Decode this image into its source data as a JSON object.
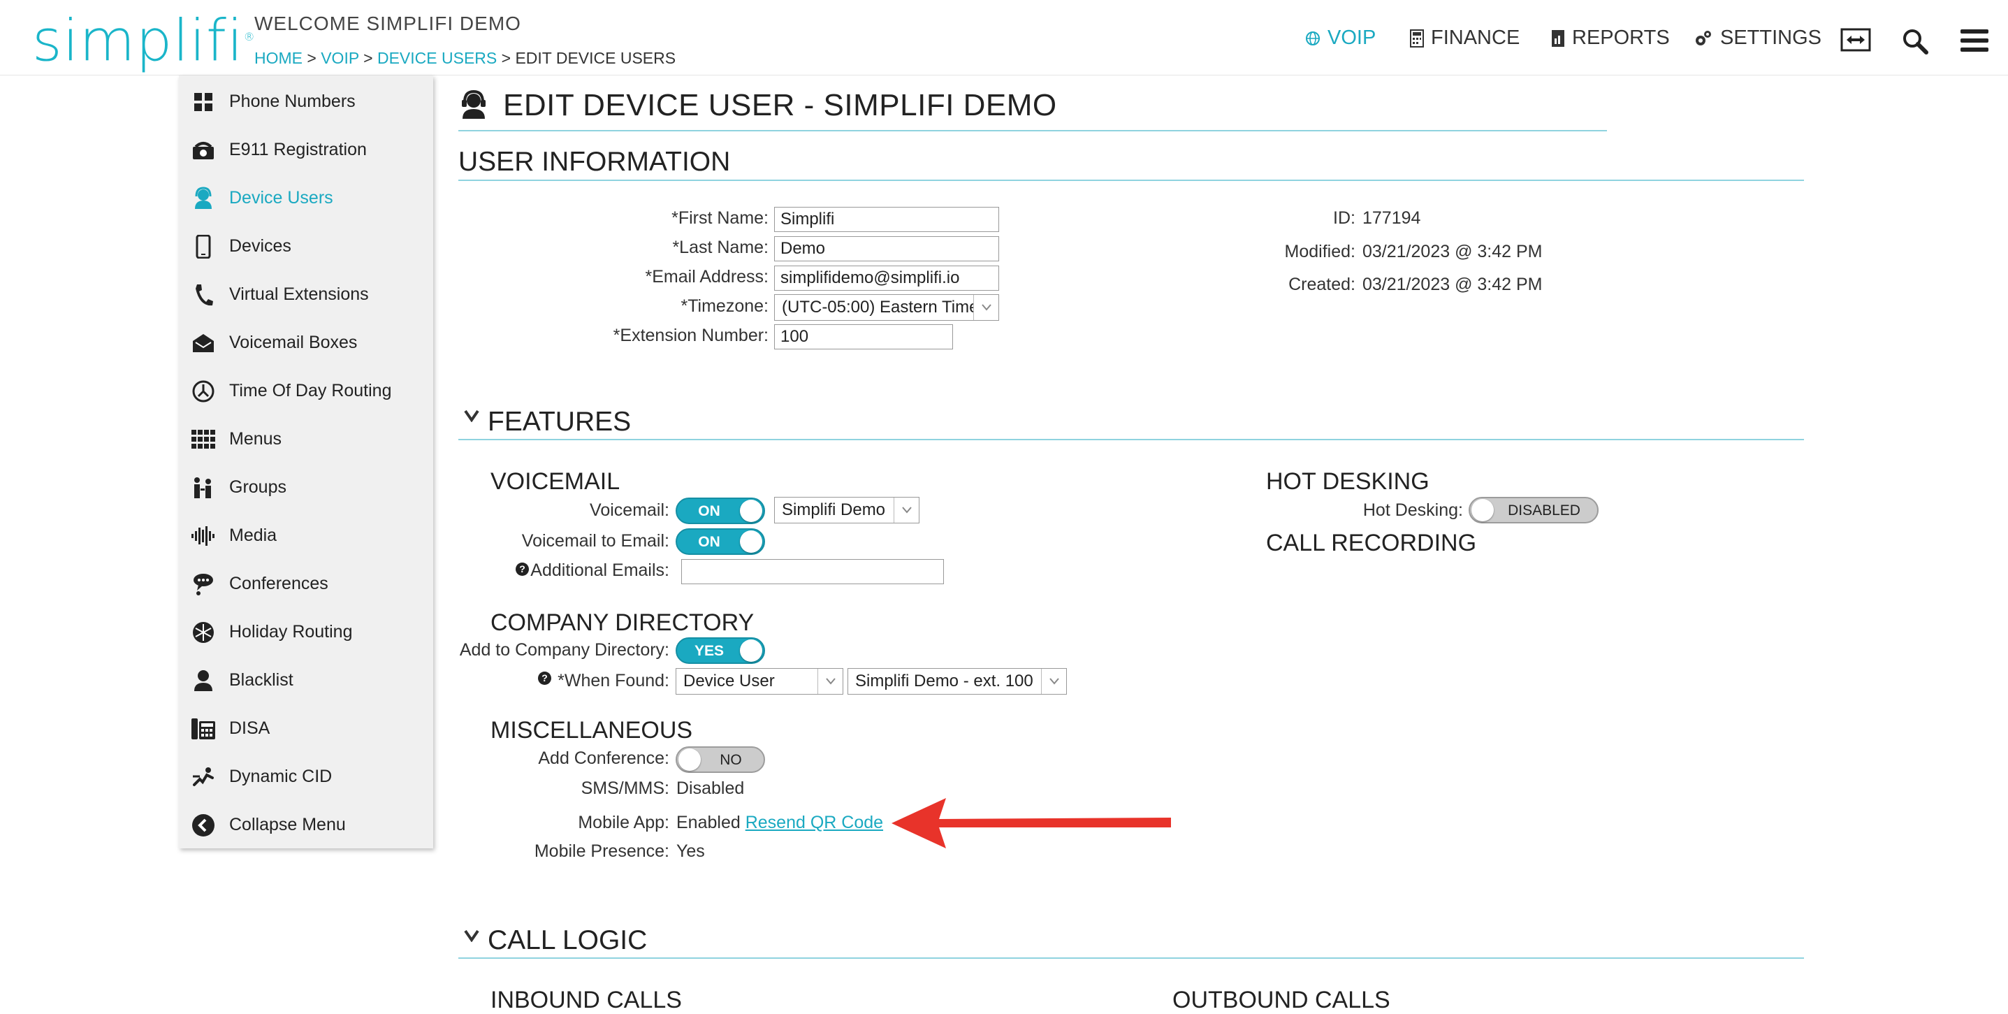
{
  "header": {
    "logo_text": "simplifi",
    "welcome": "WELCOME SIMPLIFI DEMO",
    "breadcrumb": {
      "home": "HOME",
      "voip": "VOIP",
      "device_users": "DEVICE USERS",
      "current": "EDIT DEVICE USERS",
      "sep": ">"
    },
    "nav": {
      "voip": "VOIP",
      "finance": "FINANCE",
      "reports": "REPORTS",
      "settings": "SETTINGS"
    }
  },
  "sidebar": {
    "items": [
      {
        "label": "Phone Numbers"
      },
      {
        "label": "E911 Registration"
      },
      {
        "label": "Device Users"
      },
      {
        "label": "Devices"
      },
      {
        "label": "Virtual Extensions"
      },
      {
        "label": "Voicemail Boxes"
      },
      {
        "label": "Time Of Day Routing"
      },
      {
        "label": "Menus"
      },
      {
        "label": "Groups"
      },
      {
        "label": "Media"
      },
      {
        "label": "Conferences"
      },
      {
        "label": "Holiday Routing"
      },
      {
        "label": "Blacklist"
      },
      {
        "label": "DISA"
      },
      {
        "label": "Dynamic CID"
      },
      {
        "label": "Collapse Menu"
      }
    ]
  },
  "page": {
    "title": "EDIT DEVICE USER - SIMPLIFI DEMO"
  },
  "user_info": {
    "heading": "USER INFORMATION",
    "first_name_label": "*First Name:",
    "first_name": "Simplifi",
    "last_name_label": "*Last Name:",
    "last_name": "Demo",
    "email_label": "*Email Address:",
    "email": "simplifidemo@simplifi.io",
    "timezone_label": "*Timezone:",
    "timezone": "(UTC-05:00) Eastern Time",
    "extension_label": "*Extension Number:",
    "extension": "100",
    "id_label": "ID:",
    "id": "177194",
    "modified_label": "Modified:",
    "modified": "03/21/2023 @ 3:42 PM",
    "created_label": "Created:",
    "created": "03/21/2023 @ 3:42 PM"
  },
  "features": {
    "heading": "FEATURES",
    "voicemail": {
      "heading": "VOICEMAIL",
      "voicemail_label": "Voicemail:",
      "voicemail_toggle": "ON",
      "voicemail_box": "Simplifi Demo",
      "to_email_label": "Voicemail to Email:",
      "to_email_toggle": "ON",
      "additional_emails_label": "Additional Emails:",
      "additional_emails": ""
    },
    "company_directory": {
      "heading": "COMPANY DIRECTORY",
      "add_label": "Add to Company Directory:",
      "add_toggle": "YES",
      "when_found_label": "*When Found:",
      "when_found_type": "Device User",
      "when_found_target": "Simplifi Demo - ext. 100"
    },
    "misc": {
      "heading": "MISCELLANEOUS",
      "add_conference_label": "Add Conference:",
      "add_conference_toggle": "NO",
      "sms_label": "SMS/MMS:",
      "sms": "Disabled",
      "mobile_app_label": "Mobile App:",
      "mobile_app": "Enabled",
      "resend_qr": "Resend QR Code",
      "mobile_presence_label": "Mobile Presence:",
      "mobile_presence": "Yes"
    },
    "hot_desking": {
      "heading": "HOT DESKING",
      "label": "Hot Desking:",
      "toggle": "DISABLED"
    },
    "call_recording": {
      "heading": "CALL RECORDING"
    }
  },
  "call_logic": {
    "heading": "CALL LOGIC",
    "inbound": "INBOUND CALLS",
    "outbound": "OUTBOUND CALLS"
  },
  "colors": {
    "accent": "#1aa9c1",
    "annotation_arrow": "#e8332a"
  }
}
